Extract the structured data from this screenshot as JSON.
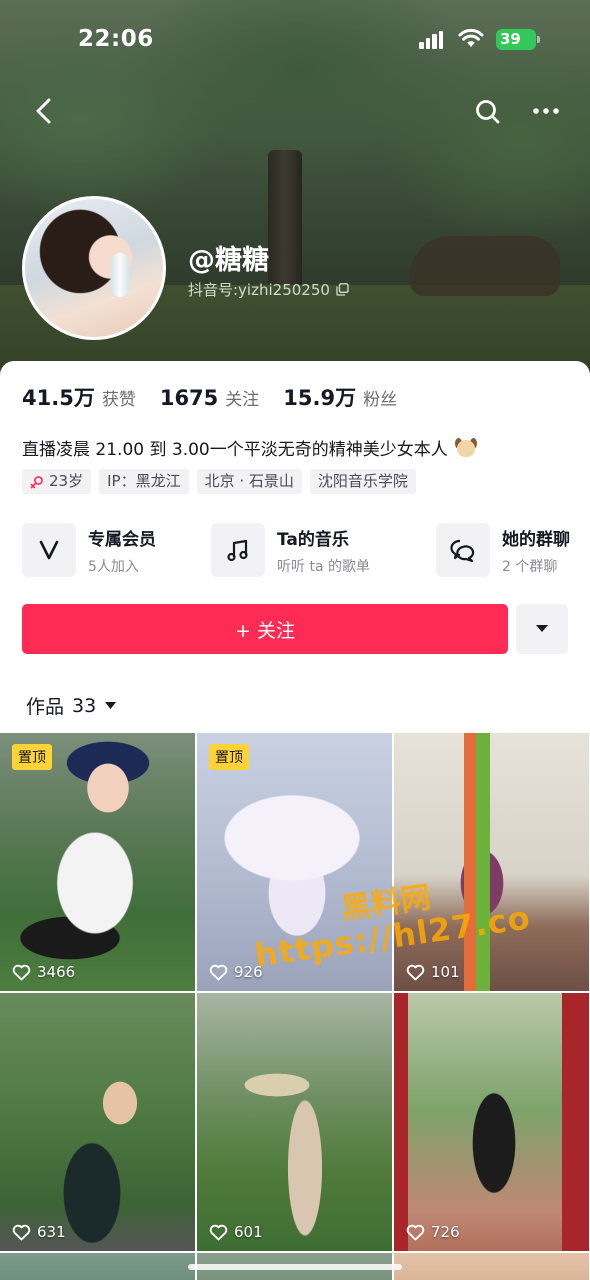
{
  "status_bar": {
    "time": "22:06",
    "battery": "39"
  },
  "profile": {
    "username": "@糖糖",
    "douyin_id": "抖音号:yizhi250250"
  },
  "stats": [
    {
      "value": "41.5万",
      "label": "获赞"
    },
    {
      "value": "1675",
      "label": "关注"
    },
    {
      "value": "15.9万",
      "label": "粉丝"
    }
  ],
  "bio": "直播凌晨 21.00 到 3.00一个平淡无奇的精神美少女本人",
  "tags": [
    {
      "text": "23岁",
      "icon": "female-icon"
    },
    {
      "text": "IP：黑龙江"
    },
    {
      "text": "北京 · 石景山"
    },
    {
      "text": "沈阳音乐学院"
    }
  ],
  "entries": [
    {
      "title": "专属会员",
      "subtitle": "5人加入",
      "icon": "vip-v-icon"
    },
    {
      "title": "Ta的音乐",
      "subtitle": "听听 ta 的歌单",
      "icon": "music-note-icon"
    },
    {
      "title": "她的群聊",
      "subtitle": "2 个群聊",
      "icon": "group-chat-icon"
    }
  ],
  "follow": {
    "label": "+ 关注"
  },
  "works_tab": {
    "label": "作品",
    "count": "33"
  },
  "videos": [
    {
      "likes": "3466",
      "pinned": "置顶"
    },
    {
      "likes": "926",
      "pinned": "置顶"
    },
    {
      "likes": "101"
    },
    {
      "likes": "631"
    },
    {
      "likes": "601"
    },
    {
      "likes": "726"
    }
  ],
  "watermark": {
    "line1": "黑料网",
    "line2": "https://hl27.co"
  },
  "colors": {
    "accent": "#fe2c55",
    "pin": "#ffd338",
    "battery": "#34c759"
  }
}
